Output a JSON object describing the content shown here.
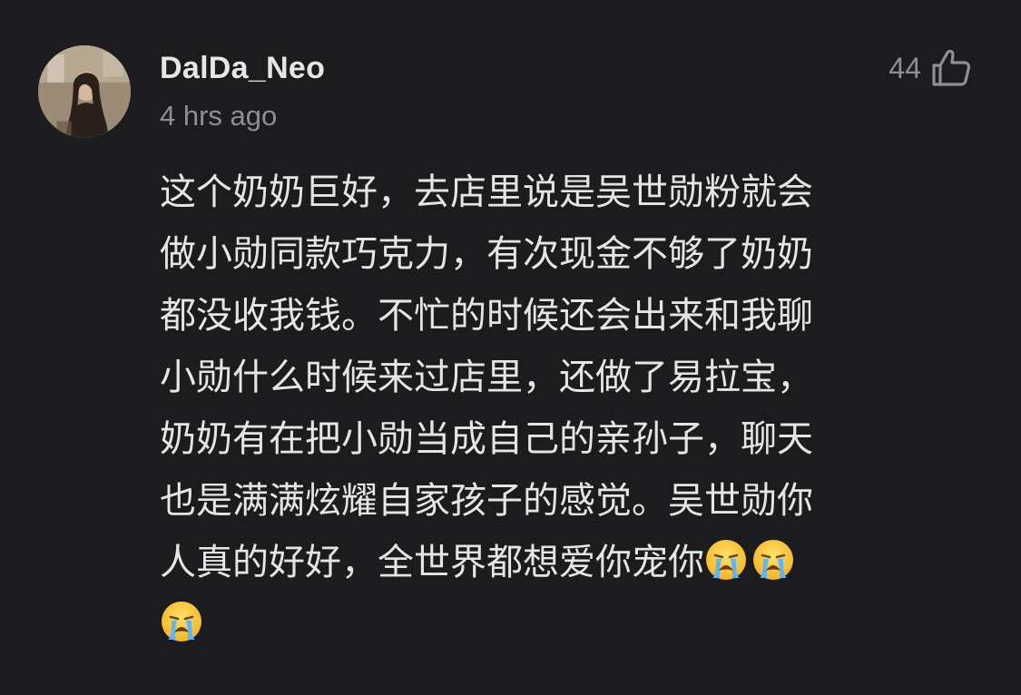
{
  "comment": {
    "username": "DalDa_Neo",
    "timestamp": "4 hrs ago",
    "like_count": "44",
    "like_icon": "thumbs-up-icon",
    "avatar_icon": "user-avatar",
    "lines": [
      "这个奶奶巨好，去店里说是吴世勋粉就会",
      "做小勋同款巧克力，有次现金不够了奶奶",
      "都没收我钱。不忙的时候还会出来和我聊",
      "小勋什么时候来过店里，还做了易拉宝，",
      "奶奶有在把小勋当成自己的亲孙子，聊天",
      "也是满满炫耀自家孩子的感觉。吴世勋你",
      "人真的好好，全世界都想爱你宠你"
    ],
    "emoji": "loudly-crying-face-icon",
    "emoji_count": 3
  },
  "colors": {
    "background": "#1c1c1e",
    "text": "#e5e5e5",
    "secondary": "#8e8e93"
  }
}
